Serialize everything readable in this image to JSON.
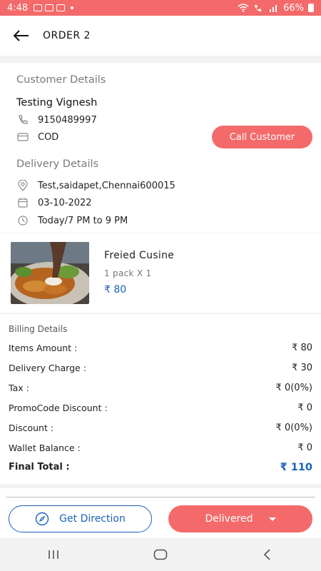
{
  "status_bar": {
    "time": "4:48",
    "battery": "66%",
    "bg_color": "#f46a6a"
  },
  "header": {
    "back_icon": "arrow-left-icon",
    "title": "ORDER 2"
  },
  "customer": {
    "section_title": "Customer Details",
    "name": "Testing Vignesh",
    "phone": "9150489997",
    "payment": "COD",
    "call_button": "Call Customer"
  },
  "delivery": {
    "section_title": "Delivery Details",
    "address": "Test,saidapet,Chennai600015",
    "date": "03-10-2022",
    "slot": "Today/7 PM to 9 PM"
  },
  "item": {
    "name": "Freied Cusine",
    "quantity": "1 pack X 1",
    "price": "₹ 80"
  },
  "billing": {
    "title": "Billing Details",
    "rows": [
      {
        "label": "Items Amount :",
        "value": "₹ 80"
      },
      {
        "label": "Delivery Charge :",
        "value": "₹ 30"
      },
      {
        "label": "Tax :",
        "value": "₹ 0(0%)"
      },
      {
        "label": "PromoCode Discount :",
        "value": "₹ 0"
      },
      {
        "label": "Discount :",
        "value": "₹ 0(0%)"
      },
      {
        "label": "Wallet Balance :",
        "value": "₹ 0"
      }
    ],
    "final_label": "Final Total :",
    "final_value": "₹ 110"
  },
  "actions": {
    "direction_label": "Get Direction",
    "status_label": "Delivered"
  },
  "colors": {
    "accent": "#f46a6a",
    "link_blue": "#1a62b8"
  }
}
